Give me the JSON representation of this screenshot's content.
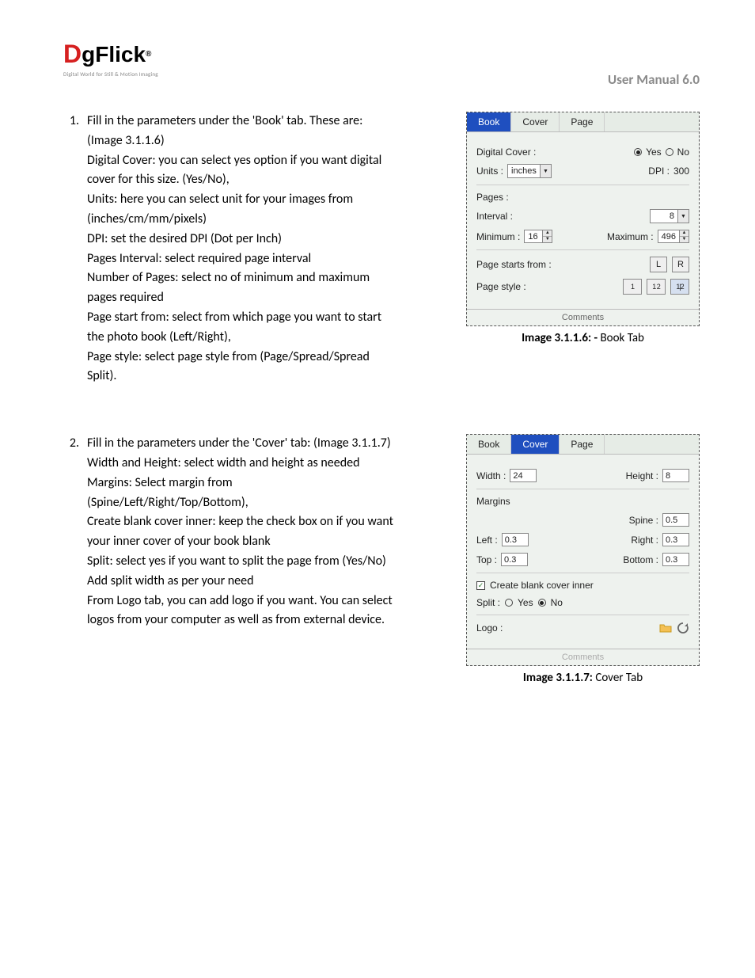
{
  "header": {
    "logo_tagline": "Digital World for Still & Motion Imaging",
    "user_manual": "User Manual 6.0"
  },
  "step1": {
    "num": "1.",
    "text": "Fill in the parameters under the 'Book' tab. These are: (Image 3.1.1.6)\nDigital Cover: you can select yes option if you want digital cover for this size. (Yes/No),\nUnits: here you can select unit for your images from (inches/cm/mm/pixels)\nDPI: set the desired DPI (Dot per Inch)\nPages Interval: select required page interval\nNumber of Pages:  select no of minimum and maximum pages required\nPage start from:  select from which page you want to start the photo book (Left/Right),\nPage style:  select page style from (Page/Spread/Spread Split)."
  },
  "step2": {
    "num": "2.",
    "text": "Fill in the parameters under the 'Cover' tab: (Image 3.1.1.7)\nWidth and Height: select width and height as needed\nMargins:  Select margin from (Spine/Left/Right/Top/Bottom),\nCreate blank cover inner:  keep the check box on if you want your inner cover of your book blank\nSplit:  select yes if you want to split the page from (Yes/No)\nAdd split width as per your need\nFrom Logo tab, you can add logo if you want. You can select logos from your computer as well as from external device."
  },
  "panel1": {
    "tabs": {
      "book": "Book",
      "cover": "Cover",
      "page": "Page"
    },
    "digital_cover_label": "Digital Cover :",
    "yes": "Yes",
    "no": "No",
    "units_label": "Units :",
    "units_value": "inches",
    "dpi_label": "DPI :",
    "dpi_value": "300",
    "pages_label": "Pages :",
    "interval_label": "Interval :",
    "interval_value": "8",
    "min_label": "Minimum :",
    "min_value": "16",
    "max_label": "Maximum :",
    "max_value": "496",
    "page_starts_label": "Page starts from :",
    "left_btn": "L",
    "right_btn": "R",
    "page_style_label": "Page style :",
    "style1": "1",
    "style2": "1 2",
    "style3": "1|2",
    "comments": "Comments"
  },
  "panel2": {
    "tabs": {
      "book": "Book",
      "cover": "Cover",
      "page": "Page"
    },
    "width_label": "Width :",
    "width_value": "24",
    "height_label": "Height :",
    "height_value": "8",
    "margins": "Margins",
    "spine_label": "Spine :",
    "spine_value": "0.5",
    "left_label": "Left :",
    "left_value": "0.3",
    "right_label": "Right :",
    "right_value": "0.3",
    "top_label": "Top :",
    "top_value": "0.3",
    "bottom_label": "Bottom :",
    "bottom_value": "0.3",
    "create_blank": "Create blank cover inner",
    "split_label": "Split :",
    "yes": "Yes",
    "no": "No",
    "logo_label": "Logo :",
    "comments": "Comments"
  },
  "captions": {
    "c1_bold": "Image 3.1.1.6: -",
    "c1_rest": " Book Tab",
    "c2_bold": "Image 3.1.1.7:",
    "c2_rest": "  Cover Tab"
  }
}
